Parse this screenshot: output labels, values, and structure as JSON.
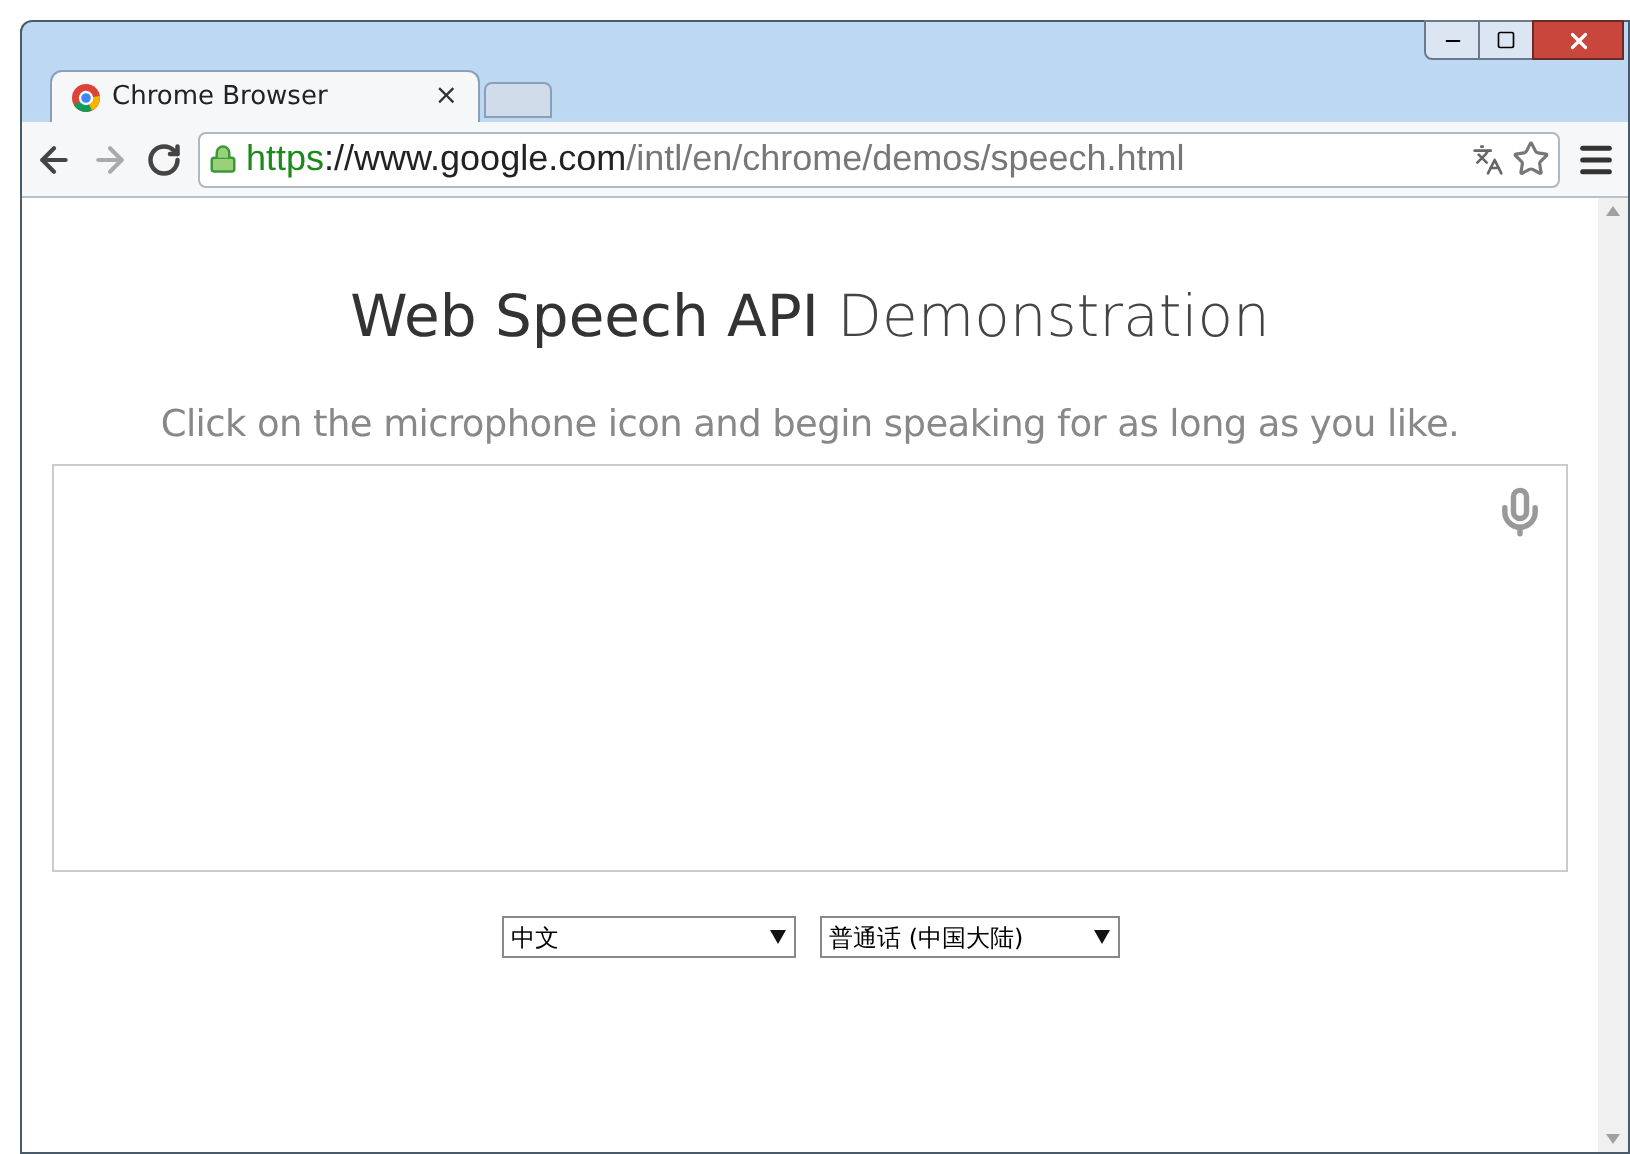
{
  "tabs": [
    {
      "kind": "page",
      "label": "Chrome Browser",
      "selected": true,
      "close": "×"
    },
    {
      "kind": "new",
      "selected": false
    }
  ],
  "address_bar": {
    "scheme": "https",
    "host": "://www.google.com",
    "path": "/intl/en/chrome/demos/speech.html",
    "secure": true
  },
  "page": {
    "title_bold": "Web Speech API",
    "title_light": "Demonstration",
    "instructions": "Click on the microphone icon and begin speaking for as long as you like."
  },
  "selects": [
    {
      "value": "中文"
    },
    {
      "value": "普通话 (中国大陆)"
    }
  ]
}
